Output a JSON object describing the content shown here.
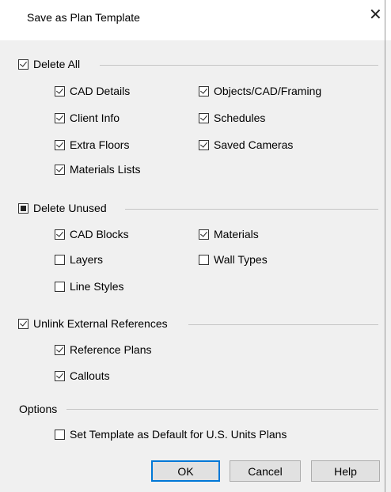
{
  "window": {
    "title": "Save as Plan Template",
    "close_icon": "✕"
  },
  "delete_all": {
    "label": "Delete All",
    "checked": true,
    "items": [
      {
        "label": "CAD Details",
        "checked": true
      },
      {
        "label": "Objects/CAD/Framing",
        "checked": true
      },
      {
        "label": "Client Info",
        "checked": true
      },
      {
        "label": "Schedules",
        "checked": true
      },
      {
        "label": "Extra Floors",
        "checked": true
      },
      {
        "label": "Saved Cameras",
        "checked": true
      },
      {
        "label": "Materials Lists",
        "checked": true
      }
    ]
  },
  "delete_unused": {
    "label": "Delete Unused",
    "state": "indeterminate",
    "items": [
      {
        "label": "CAD Blocks",
        "checked": true
      },
      {
        "label": "Materials",
        "checked": true
      },
      {
        "label": "Layers",
        "checked": false
      },
      {
        "label": "Wall Types",
        "checked": false
      },
      {
        "label": "Line Styles",
        "checked": false
      }
    ]
  },
  "unlink_refs": {
    "label": "Unlink External References",
    "checked": true,
    "items": [
      {
        "label": "Reference Plans",
        "checked": true
      },
      {
        "label": "Callouts",
        "checked": true
      }
    ]
  },
  "options": {
    "label": "Options",
    "default_template": {
      "label": "Set Template as Default for U.S. Units Plans",
      "checked": false
    }
  },
  "buttons": {
    "ok": "OK",
    "cancel": "Cancel",
    "help": "Help"
  },
  "colors": {
    "accent": "#0078d7",
    "background": "#f0f0f0",
    "titlebar": "#ffffff"
  }
}
